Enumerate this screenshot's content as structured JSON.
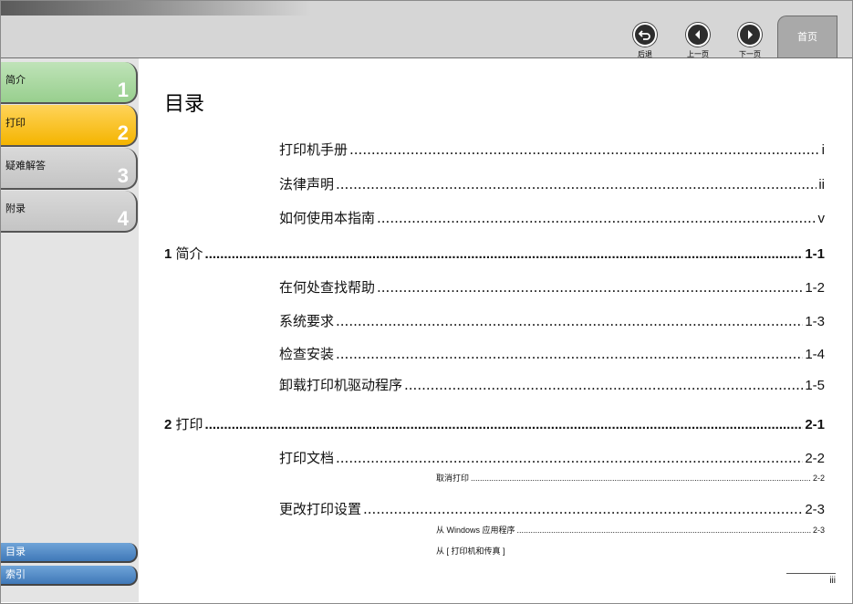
{
  "nav": {
    "back_label": "后退",
    "prev_label": "上一页",
    "next_label": "下一页",
    "home_label": "首页"
  },
  "sidebar": {
    "tabs": [
      {
        "label": "简介",
        "num": "1"
      },
      {
        "label": "打印",
        "num": "2"
      },
      {
        "label": "疑难解答",
        "num": "3"
      },
      {
        "label": "附录",
        "num": "4"
      }
    ],
    "toc_label": "目录",
    "index_label": "索引"
  },
  "content": {
    "title": "目录",
    "entries": [
      {
        "text": "打印机手册",
        "page": "i"
      },
      {
        "text": "法律声明",
        "page": "ii"
      },
      {
        "text": "如何使用本指南",
        "page": "v"
      },
      {
        "num": "1",
        "text": "简介",
        "page": "1-1"
      },
      {
        "text": "在何处查找帮助",
        "page": "1-2"
      },
      {
        "text": "系统要求",
        "page": "1-3"
      },
      {
        "text": "检查安装",
        "page": "1-4"
      },
      {
        "text": "卸载打印机驱动程序",
        "page": "1-5"
      },
      {
        "num": "2",
        "text": "打印",
        "page": "2-1"
      },
      {
        "text": "打印文档",
        "page": "2-2"
      },
      {
        "text": "取消打印",
        "page": "2-2"
      },
      {
        "text": "更改打印设置",
        "page": "2-3"
      },
      {
        "text": "从 Windows 应用程序",
        "page": "2-3"
      },
      {
        "text": "从 [ 打印机和传真 ]",
        "page": ""
      }
    ],
    "page_number": "iii"
  }
}
